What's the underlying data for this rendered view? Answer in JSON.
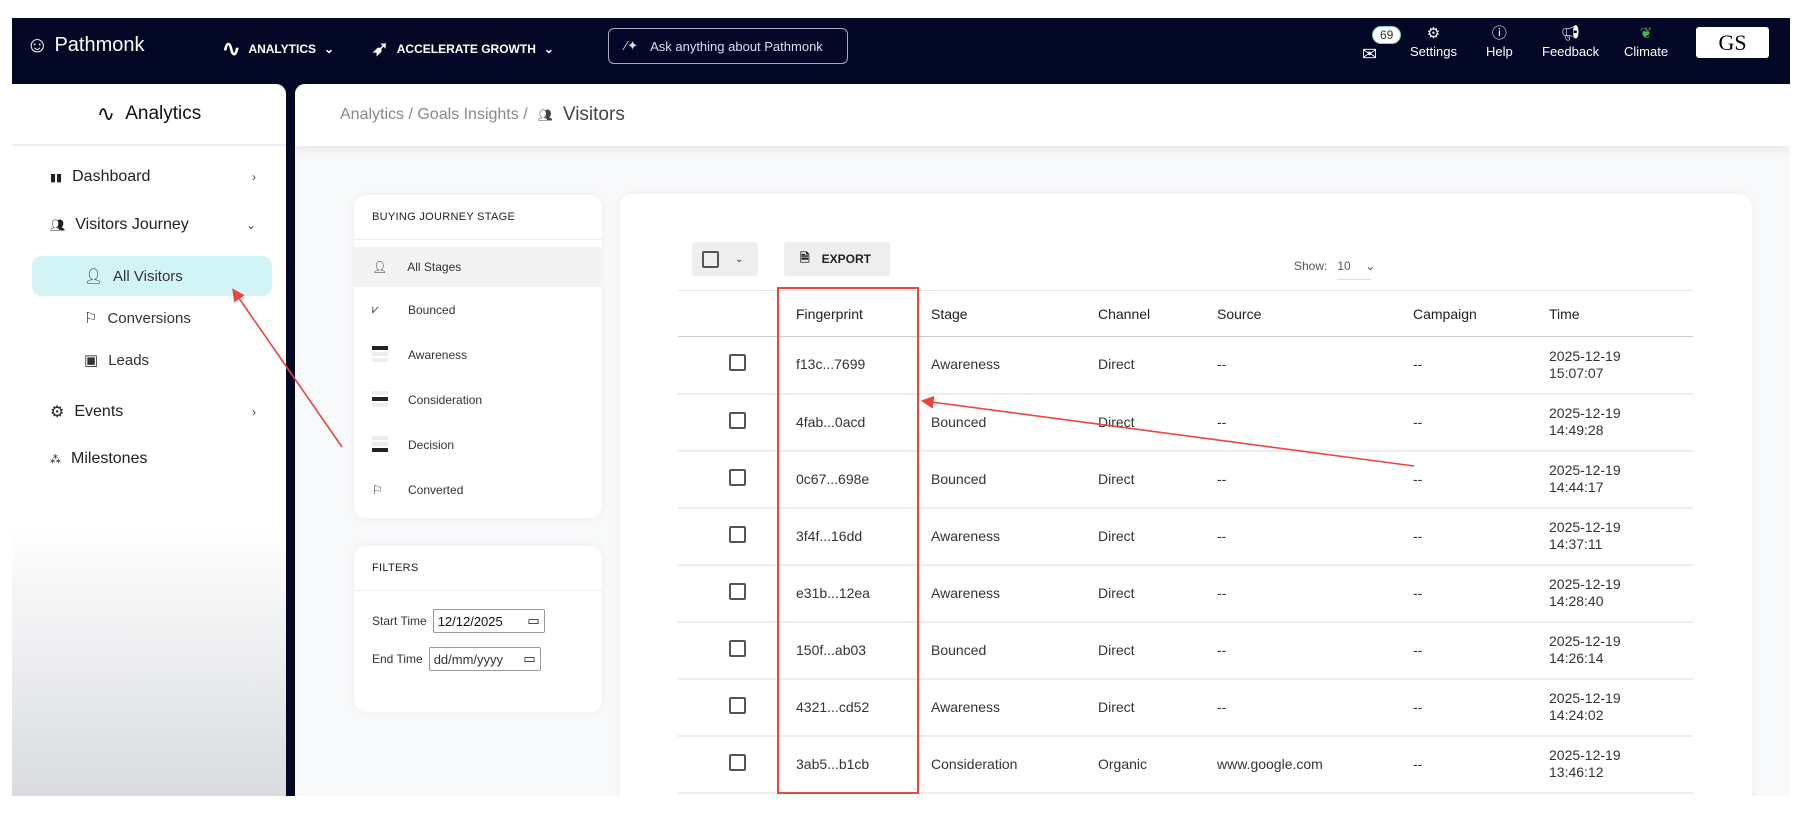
{
  "topbar": {
    "brand": "Pathmonk",
    "menu_analytics": "ANALYTICS",
    "menu_growth": "ACCELERATE GROWTH",
    "ask_placeholder": "Ask anything about Pathmonk",
    "messages_count": "69",
    "settings": "Settings",
    "help": "Help",
    "feedback": "Feedback",
    "climate": "Climate",
    "account": "GS"
  },
  "sidebar": {
    "title": "Analytics",
    "items": [
      {
        "label": "Dashboard"
      },
      {
        "label": "Visitors Journey"
      },
      {
        "label": "Events"
      },
      {
        "label": "Milestones"
      }
    ],
    "sub_items": [
      {
        "label": "All Visitors"
      },
      {
        "label": "Conversions"
      },
      {
        "label": "Leads"
      }
    ]
  },
  "breadcrumb": {
    "path": "Analytics / Goals Insights /",
    "current": "Visitors"
  },
  "stages": {
    "title": "BUYING JOURNEY STAGE",
    "items": [
      {
        "label": "All Stages"
      },
      {
        "label": "Bounced"
      },
      {
        "label": "Awareness"
      },
      {
        "label": "Consideration"
      },
      {
        "label": "Decision"
      },
      {
        "label": "Converted"
      }
    ]
  },
  "filters": {
    "title": "FILTERS",
    "start_label": "Start Time",
    "start_value": "12/12/2025",
    "end_label": "End Time",
    "end_value": "dd/mm/yyyy"
  },
  "toolbar": {
    "export": "EXPORT",
    "show_label": "Show:",
    "show_value": "10"
  },
  "table": {
    "columns": [
      "Fingerprint",
      "Stage",
      "Channel",
      "Source",
      "Campaign",
      "Time"
    ],
    "rows": [
      [
        "f13c...7699",
        "Awareness",
        "Direct",
        "--",
        "--",
        "2025-12-19",
        "15:07:07"
      ],
      [
        "4fab...0acd",
        "Bounced",
        "Direct",
        "--",
        "--",
        "2025-12-19",
        "14:49:28"
      ],
      [
        "0c67...698e",
        "Bounced",
        "Direct",
        "--",
        "--",
        "2025-12-19",
        "14:44:17"
      ],
      [
        "3f4f...16dd",
        "Awareness",
        "Direct",
        "--",
        "--",
        "2025-12-19",
        "14:37:11"
      ],
      [
        "e31b...12ea",
        "Awareness",
        "Direct",
        "--",
        "--",
        "2025-12-19",
        "14:28:40"
      ],
      [
        "150f...ab03",
        "Bounced",
        "Direct",
        "--",
        "--",
        "2025-12-19",
        "14:26:14"
      ],
      [
        "4321...cd52",
        "Awareness",
        "Direct",
        "--",
        "--",
        "2025-12-19",
        "14:24:02"
      ],
      [
        "3ab5...b1cb",
        "Consideration",
        "Organic",
        "www.google.com",
        "--",
        "2025-12-19",
        "13:46:12"
      ]
    ]
  },
  "colors": {
    "navy": "#020826",
    "active_bg": "#d2f4f6",
    "annotation": "#e8473f",
    "climate": "#4caf50"
  }
}
